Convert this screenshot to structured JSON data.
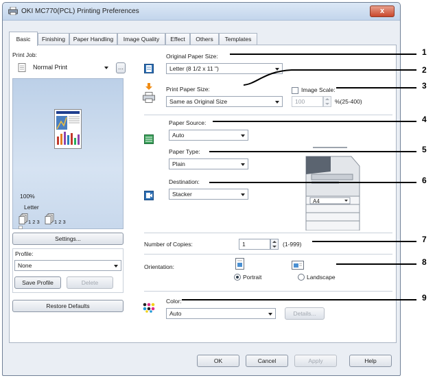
{
  "window": {
    "title": "OKI MC770(PCL) Printing Preferences",
    "close_label": "x"
  },
  "tabs": [
    {
      "label": "Basic",
      "active": true
    },
    {
      "label": "Finishing"
    },
    {
      "label": "Paper Handling"
    },
    {
      "label": "Image Quality"
    },
    {
      "label": "Effect"
    },
    {
      "label": "Others"
    },
    {
      "label": "Templates"
    }
  ],
  "left": {
    "print_job_label": "Print Job:",
    "print_job_value": "Normal Print",
    "preview_scale": "100%",
    "preview_paper": "Letter",
    "collate_1": "1 2 3",
    "collate_2": "1 2 3",
    "settings_button": "Settings...",
    "profile_label": "Profile:",
    "profile_value": "None",
    "save_profile_button": "Save Profile",
    "delete_button": "Delete",
    "restore_defaults_button": "Restore Defaults"
  },
  "right": {
    "original_paper_size_label": "Original Paper Size:",
    "original_paper_size_value": "Letter (8 1/2 x 11 \")",
    "print_paper_size_label": "Print Paper Size:",
    "print_paper_size_value": "Same as Original Size",
    "image_scale_label": "Image Scale:",
    "image_scale_value": "100",
    "image_scale_range": "%(25-400)",
    "paper_source_label": "Paper Source:",
    "paper_source_value": "Auto",
    "paper_type_label": "Paper Type:",
    "paper_type_value": "Plain",
    "destination_label": "Destination:",
    "destination_value": "Stacker",
    "printer_paper_display": "A4",
    "copies_label": "Number of Copies:",
    "copies_value": "1",
    "copies_range": "(1-999)",
    "orientation_label": "Orientation:",
    "portrait_label": "Portrait",
    "landscape_label": "Landscape",
    "orientation_selected": "Portrait",
    "color_label": "Color:",
    "color_value": "Auto",
    "details_button": "Details..."
  },
  "footer": {
    "ok_button": "OK",
    "cancel_button": "Cancel",
    "apply_button": "Apply",
    "help_button": "Help"
  },
  "callouts": [
    "1",
    "2",
    "3",
    "4",
    "5",
    "6",
    "7",
    "8",
    "9"
  ],
  "colors": {
    "title_gradient_top": "#dce8f6",
    "close_red": "#c9472c",
    "panel_bg": "#ffffff",
    "window_bg": "#eaeef4"
  }
}
